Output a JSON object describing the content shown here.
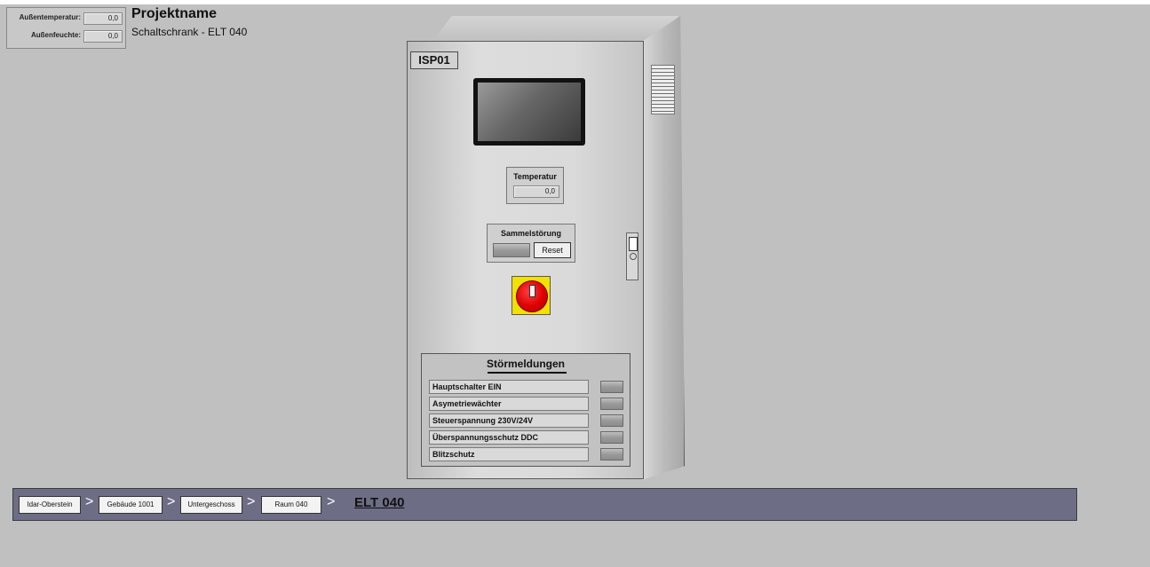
{
  "weather": {
    "outside_temp_label": "Außentemperatur:",
    "outside_temp_value": "0,0",
    "outside_humidity_label": "Außenfeuchte:",
    "outside_humidity_value": "0,0"
  },
  "project": {
    "title": "Projektname",
    "subtitle": "Schaltschrank - ELT 040"
  },
  "cabinet": {
    "tag": "ISP01",
    "temperature_label": "Temperatur",
    "temperature_value": "0,0",
    "alarm_label": "Sammelstörung",
    "reset_label": "Reset"
  },
  "faults": {
    "title": "Störmeldungen",
    "items": [
      {
        "label": "Hauptschalter EIN"
      },
      {
        "label": "Asymetriewächter"
      },
      {
        "label": "Steuerspannung 230V/24V"
      },
      {
        "label": "Überspannungsschutz DDC"
      },
      {
        "label": "Blitzschutz"
      }
    ]
  },
  "breadcrumb": {
    "items": [
      "Idar-Oberstein",
      "Gebäude 1001",
      "Untergeschoss",
      "Raum 040"
    ],
    "separator": ">",
    "current": "ELT 040"
  },
  "colors": {
    "background": "#c0c0c0",
    "breadcrumb_bar": "#6d6d86",
    "switch_yellow": "#f2e000",
    "switch_red": "#dd0000"
  }
}
